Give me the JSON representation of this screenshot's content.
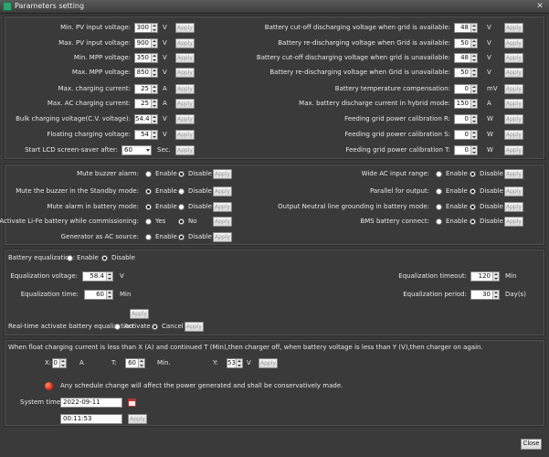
{
  "window": {
    "title": "Parameters setting",
    "close_glyph": "✕"
  },
  "common": {
    "apply": "Apply",
    "enable": "Enable",
    "disable": "Disable",
    "yes": "Yes",
    "no": "No",
    "activate": "Activate",
    "cancel": "Cancel"
  },
  "left_params": [
    {
      "label": "Min. PV input voltage:",
      "value": "300",
      "unit": "V"
    },
    {
      "label": "Max. PV input voltage:",
      "value": "900",
      "unit": "V"
    },
    {
      "label": "Min. MPP voltage:",
      "value": "350",
      "unit": "V"
    },
    {
      "label": "Max. MPP voltage:",
      "value": "850",
      "unit": "V"
    },
    {
      "label": "Max. charging current:",
      "value": "25",
      "unit": "A"
    },
    {
      "label": "Max. AC charging current:",
      "value": "25",
      "unit": "A"
    },
    {
      "label": "Bulk charging voltage(C.V. voltage):",
      "value": "54.4",
      "unit": "V"
    },
    {
      "label": "Floating charging voltage:",
      "value": "54",
      "unit": "V"
    }
  ],
  "lcd": {
    "label": "Start LCD screen-saver after:",
    "value": "60",
    "unit": "Sec."
  },
  "right_params": [
    {
      "label": "Battery cut-off discharging voltage when grid is available:",
      "value": "48",
      "unit": "V"
    },
    {
      "label": "Battery re-discharging voltage when Grid is available:",
      "value": "50",
      "unit": "V"
    },
    {
      "label": "Battery cut-off discharging voltage when grid is unavailable:",
      "value": "48",
      "unit": "V"
    },
    {
      "label": "Battery re-discharging voltage when Grid is unavailable:",
      "value": "50",
      "unit": "V"
    },
    {
      "label": "Battery temperature compensation:",
      "value": "0",
      "unit": "mV"
    },
    {
      "label": "Max. battery discharge current in hybrid mode:",
      "value": "150",
      "unit": "A"
    },
    {
      "label": "Feeding grid power calibration R:",
      "value": "0",
      "unit": "W"
    },
    {
      "label": "Feeding grid power calibration S:",
      "value": "0",
      "unit": "W"
    },
    {
      "label": "Feeding grid power calibration T:",
      "value": "0",
      "unit": "W"
    }
  ],
  "left_toggles": [
    {
      "label": "Mute buzzer alarm:",
      "opt1": "Enable",
      "opt2": "Disable",
      "selected": 2
    },
    {
      "label": "Mute the buzzer in the Standby mode:",
      "opt1": "Enable",
      "opt2": "Disable",
      "selected": 1
    },
    {
      "label": "Mute alarm in battery mode:",
      "opt1": "Enable",
      "opt2": "Disable",
      "selected": 1
    },
    {
      "label": "Activate Li-Fe battery while commissioning:",
      "opt1": "Yes",
      "opt2": "No",
      "selected": 2
    },
    {
      "label": "Generator as AC source:",
      "opt1": "Enable",
      "opt2": "Disable",
      "selected": 2
    }
  ],
  "right_toggles": [
    {
      "label": "Wide AC input range:",
      "opt1": "Enable",
      "opt2": "Disable",
      "selected": 2
    },
    {
      "label": "Parallel for output:",
      "opt1": "Enable",
      "opt2": "Disable",
      "selected": 2
    },
    {
      "label": "Output Neutral line grounding in battery mode:",
      "opt1": "Enable",
      "opt2": "Disable",
      "selected": 2
    },
    {
      "label": "BMS battery connect:",
      "opt1": "Enable",
      "opt2": "Disable",
      "selected": 2
    }
  ],
  "equalization": {
    "label": "Battery equalization:",
    "selected": 2,
    "voltage_label": "Equalization voltage:",
    "voltage": "58.4",
    "voltage_unit": "V",
    "time_label": "Equalization time:",
    "time": "60",
    "time_unit": "Min",
    "timeout_label": "Equalization timeout:",
    "timeout": "120",
    "timeout_unit": "Min",
    "period_label": "Equalization period:",
    "period": "30",
    "period_unit": "Day(s)",
    "realtime_label": "Real-time activate battery equalization:",
    "realtime_selected": 2
  },
  "float_charge": {
    "text": "When float charging current is less than X (A) and continued T (Min),then charger off, when battery voltage is less than Y (V),then charger on again.",
    "x_label": "X:",
    "x_value": "0",
    "x_unit": "A",
    "t_label": "T:",
    "t_value": "60",
    "t_unit": "Min.",
    "y_label": "Y:",
    "y_value": "53",
    "y_unit": "V"
  },
  "schedule": {
    "warning": "Any schedule change will affect the power generated and shall be conservatively made.",
    "system_time_label": "System time:",
    "date": "2022-09-11",
    "time": "00:11:53"
  },
  "footer": {
    "close": "Close"
  }
}
